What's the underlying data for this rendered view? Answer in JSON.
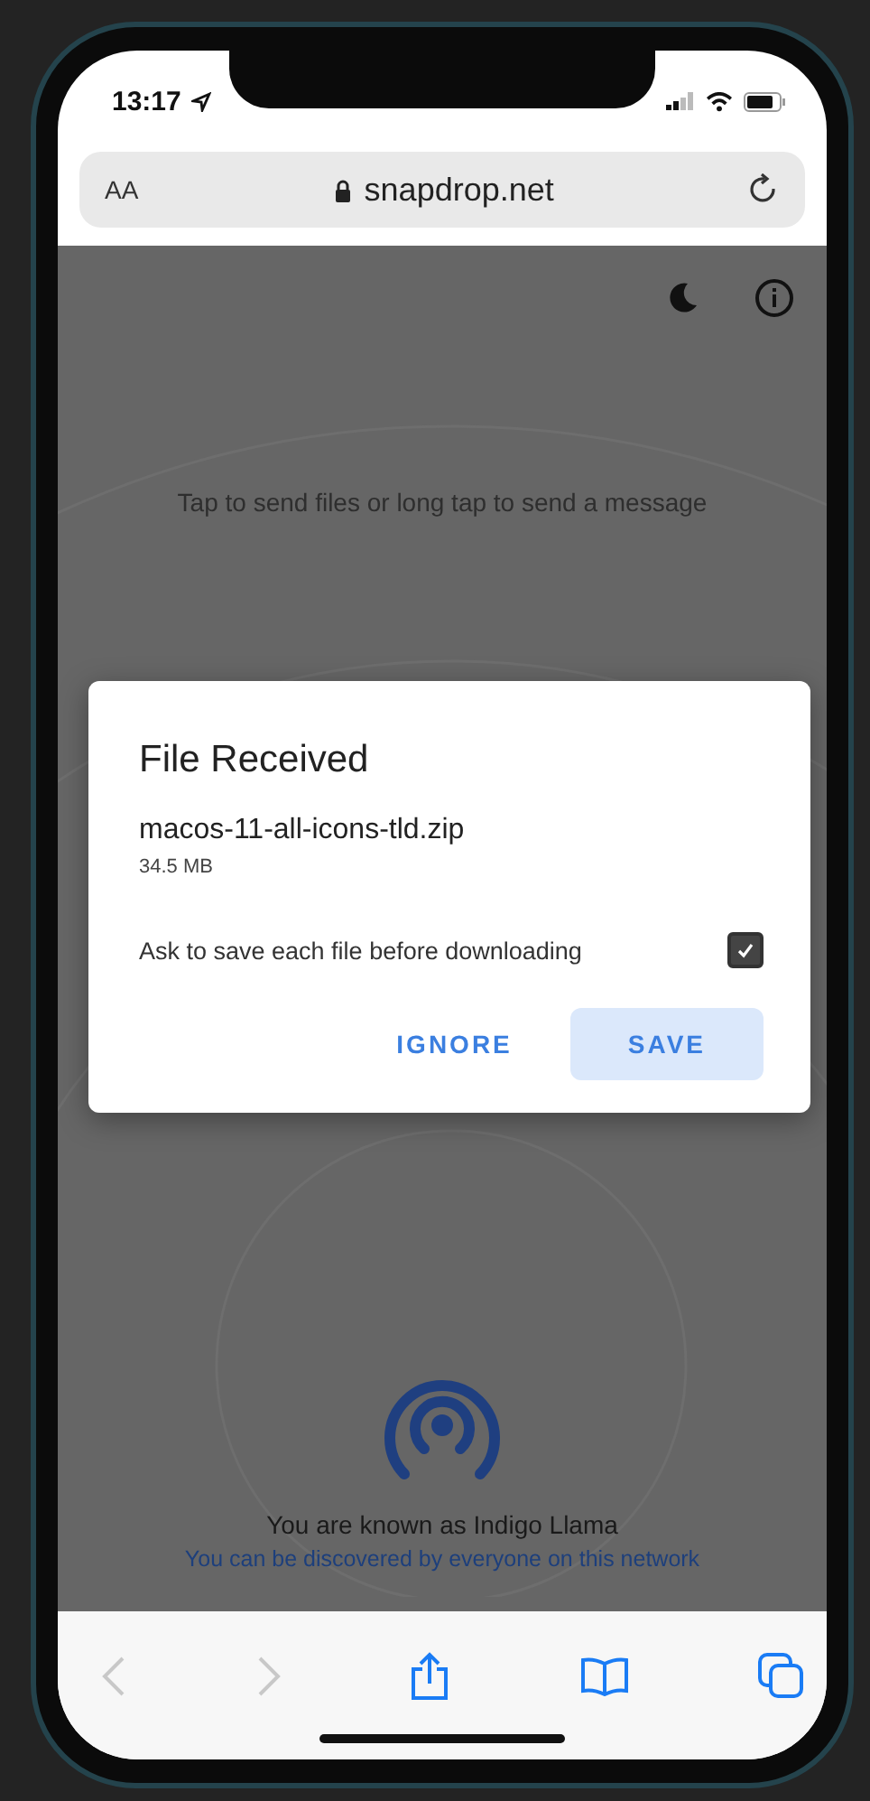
{
  "status_bar": {
    "time": "13:17"
  },
  "address_bar": {
    "text_size_button": "AA",
    "url": "snapdrop.net"
  },
  "page": {
    "hint": "Tap to send files or long tap to send a message",
    "known_as": "You are known as Indigo Llama",
    "discoverable": "You can be discovered by everyone on this network"
  },
  "dialog": {
    "title": "File Received",
    "file_name": "macos-11-all-icons-tld.zip",
    "file_size": "34.5 MB",
    "ask_option": {
      "label": "Ask to save each file before downloading",
      "checked": true
    },
    "buttons": [
      {
        "label": "IGNORE",
        "kind": "text"
      },
      {
        "label": "SAVE",
        "kind": "filled"
      }
    ]
  },
  "toolbar": [
    {
      "kind": "back",
      "disabled": true
    },
    {
      "kind": "forward",
      "disabled": true
    },
    {
      "kind": "share",
      "disabled": false
    },
    {
      "kind": "bookmarks",
      "disabled": false
    },
    {
      "kind": "tabs",
      "disabled": false
    }
  ]
}
